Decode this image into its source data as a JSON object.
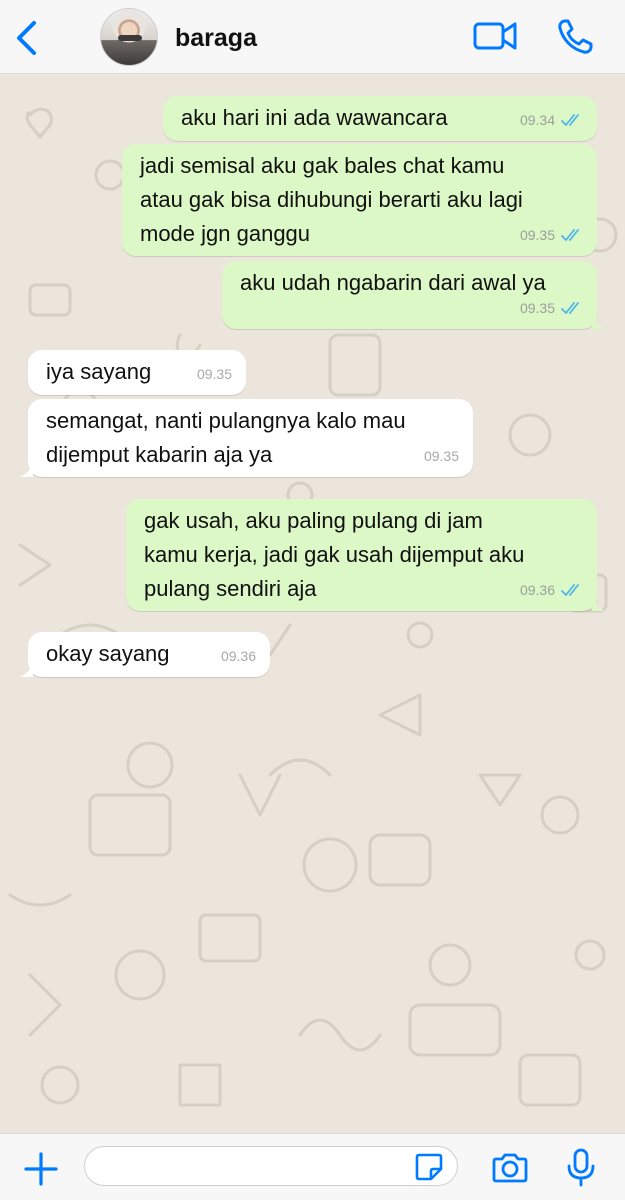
{
  "header": {
    "contact_name": "baraga"
  },
  "icons": {
    "back": "chevron-left-icon",
    "video": "video-camera-icon",
    "call": "phone-icon",
    "plus": "plus-icon",
    "sticker": "sticker-icon",
    "camera": "camera-icon",
    "mic": "microphone-icon"
  },
  "colors": {
    "accent": "#007aff",
    "outgoing_bubble": "#dcf8c6",
    "incoming_bubble": "#ffffff",
    "read_ticks": "#4fb6ec"
  },
  "messages": [
    {
      "direction": "outgoing",
      "text": "aku hari ini ada wawancara",
      "time": "09.34",
      "status": "read"
    },
    {
      "direction": "outgoing",
      "text": "jadi semisal aku gak bales chat kamu\natau gak bisa dihubungi berarti aku lagi\nmode jgn ganggu",
      "time": "09.35",
      "status": "read"
    },
    {
      "direction": "outgoing",
      "text": "aku udah ngabarin dari awal ya",
      "time": "09.35",
      "status": "read"
    },
    {
      "direction": "incoming",
      "text": "iya sayang",
      "time": "09.35"
    },
    {
      "direction": "incoming",
      "text": "semangat, nanti pulangnya kalo mau\ndijemput kabarin aja ya",
      "time": "09.35"
    },
    {
      "direction": "outgoing",
      "text": "gak usah, aku paling pulang di jam\nkamu kerja, jadi gak usah dijemput aku\npulang sendiri aja",
      "time": "09.36",
      "status": "read"
    },
    {
      "direction": "incoming",
      "text": "okay sayang",
      "time": "09.36"
    }
  ],
  "composer": {
    "input_value": ""
  }
}
